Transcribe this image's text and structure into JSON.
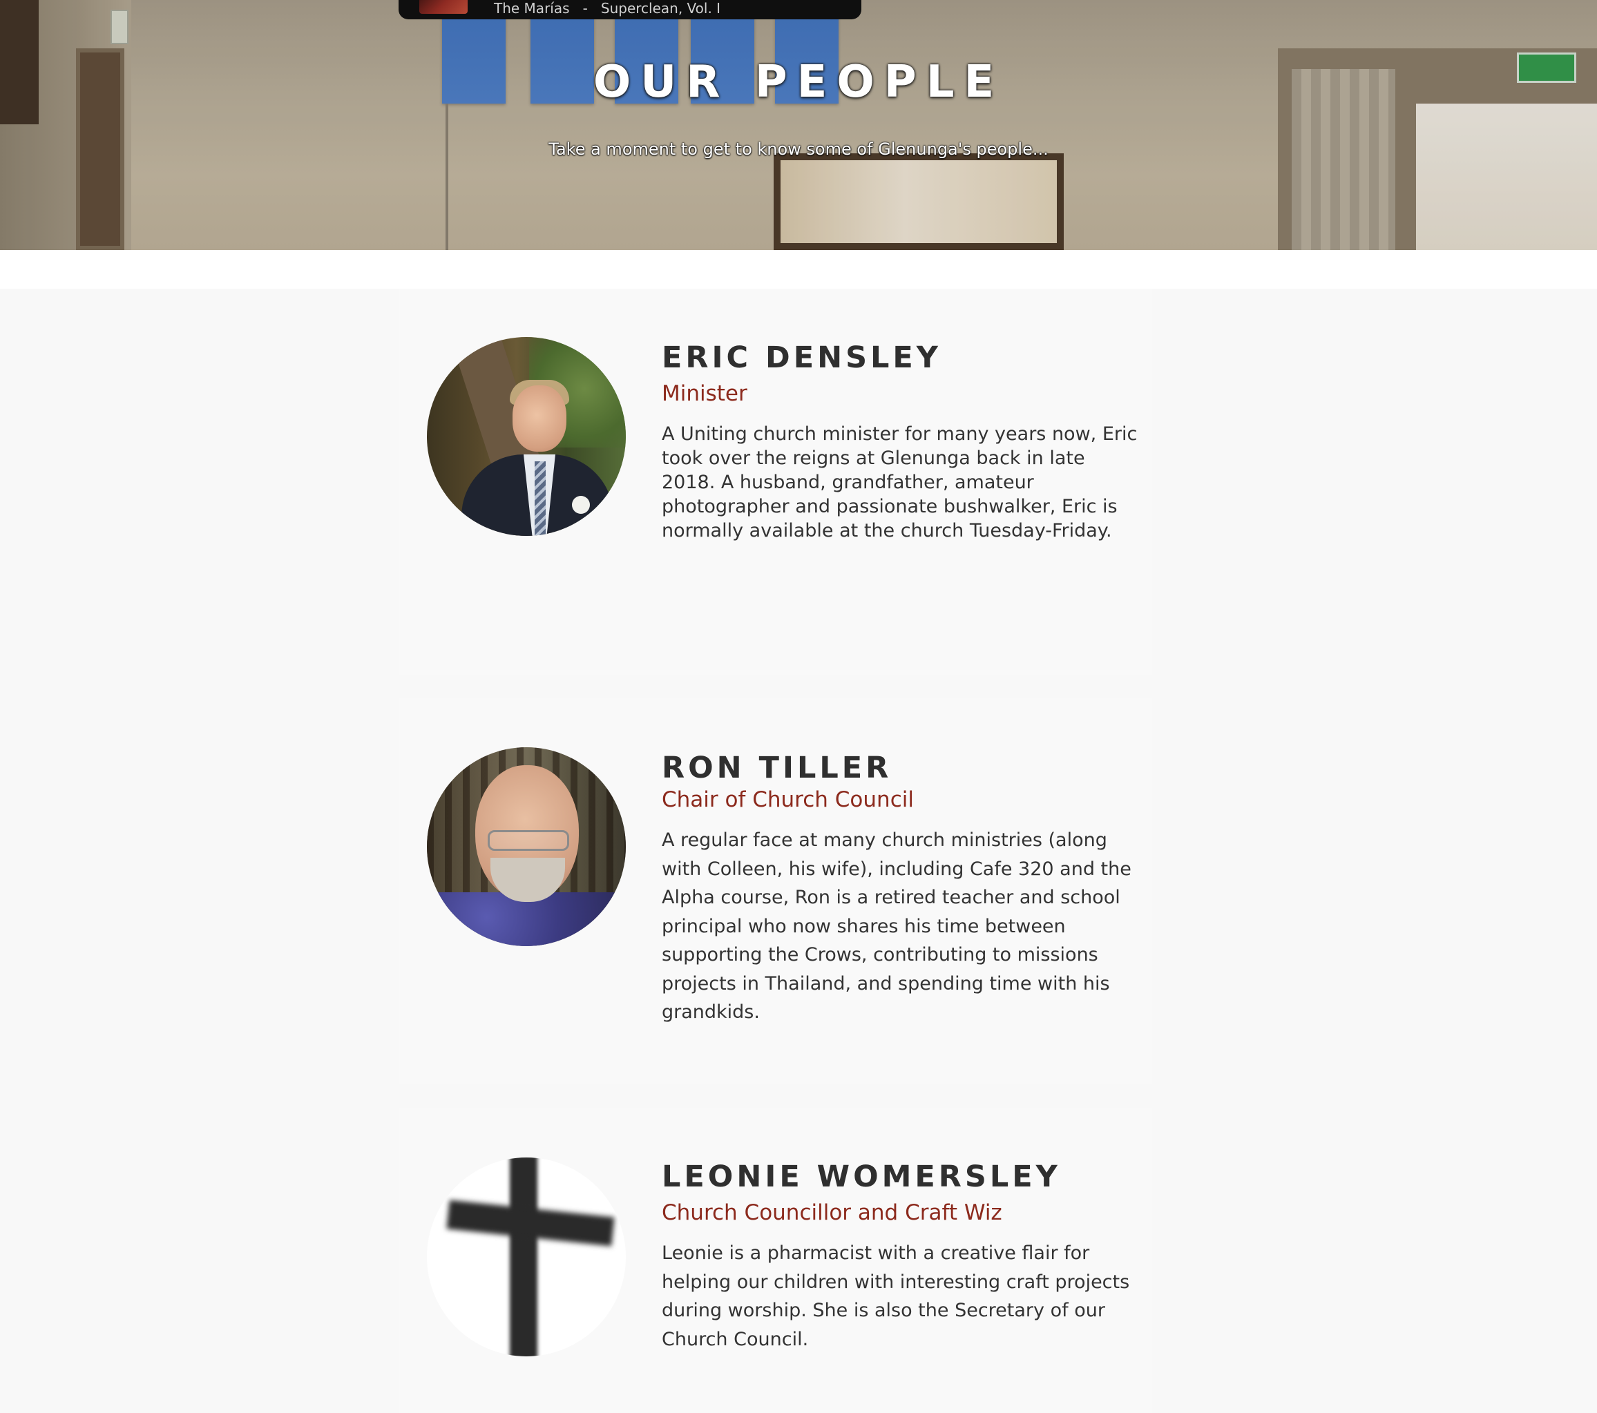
{
  "player": {
    "track": "The Marías   -   Superclean, Vol. I"
  },
  "hero": {
    "title": "OUR PEOPLE",
    "subtitle": "Take a moment to get to know some of Glenunga's people..."
  },
  "people": [
    {
      "name": "ERIC DENSLEY",
      "role": "Minister",
      "bio": "A Uniting church minister for many years now, Eric took over the reigns at Glenunga back in late 2018. A husband, grandfather, amateur photographer and passionate bushwalker, Eric is normally available at the church Tuesday-Friday."
    },
    {
      "name": "RON TILLER",
      "role": "Chair of Church Council",
      "bio": "A regular face at many church ministries (along with Colleen, his wife), including Cafe 320 and the Alpha course, Ron is a retired teacher and school principal who now shares his time between supporting the Crows, contributing to missions projects in Thailand, and spending time with his grandkids."
    },
    {
      "name": "LEONIE WOMERSLEY",
      "role": "Church Councillor and Craft Wiz",
      "bio": "Leonie is a pharmacist with a creative flair for helping our children with interesting craft projects during worship.  She is also the Secretary of our Church Council."
    }
  ],
  "colors": {
    "role_accent": "#8c2a1d",
    "name_text": "#2f2f2f",
    "section_bg": "#f8f8f8"
  }
}
